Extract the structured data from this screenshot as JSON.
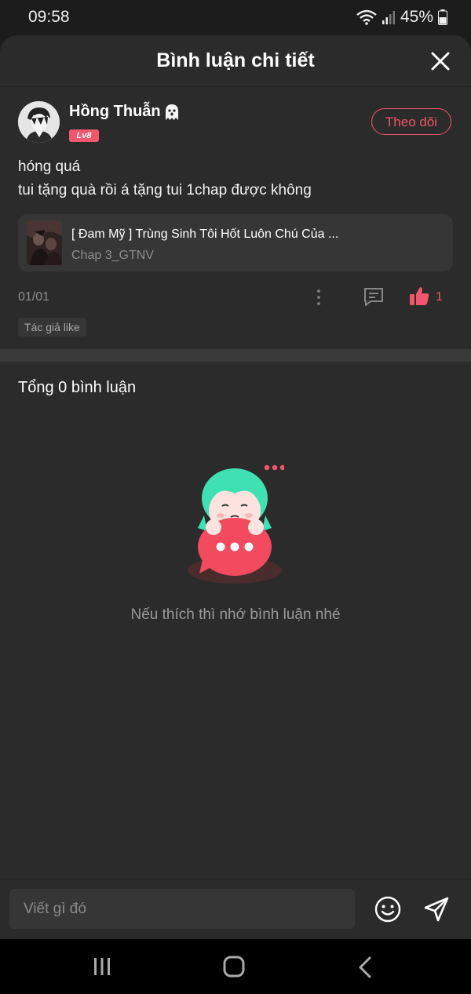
{
  "status_bar": {
    "time": "09:58",
    "battery": "45%"
  },
  "header": {
    "title": "Bình luận chi tiết"
  },
  "comment": {
    "user_name": "Hồng Thuẫn",
    "level": "Lv8",
    "follow_label": "Theo dõi",
    "lines": [
      "hóng quá",
      "tui tặng quà rồi á tặng tui 1chap được không"
    ],
    "chapter": {
      "title": "[ Đam Mỹ ] Trùng Sinh Tôi Hốt Luôn Chú Của ...",
      "subtitle": "Chap 3_GTNV"
    },
    "date": "01/01",
    "like_count": "1",
    "author_tag": "Tác giả like"
  },
  "comments_section": {
    "total_label": "Tổng 0 bình luận",
    "empty_text": "Nếu thích thì nhớ bình luận nhé"
  },
  "input": {
    "placeholder": "Viết gì đó"
  },
  "colors": {
    "accent": "#f0566d",
    "background": "#2b2b2b",
    "card": "#363636"
  }
}
